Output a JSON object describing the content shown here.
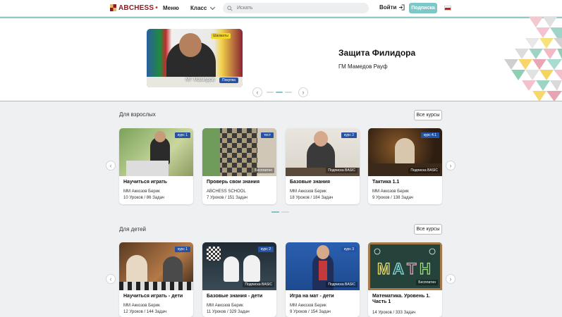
{
  "header": {
    "logo": "ABCHESS",
    "menu": "Меню",
    "class": "Класс",
    "search_placeholder": "Искать",
    "login": "Войти",
    "subscribe": "Подписка"
  },
  "hero": {
    "title": "Защита Филидора",
    "author": "ГМ Мамедов Рауф",
    "image_label": "МГ Мамедов",
    "tag": "Шахматы",
    "badge": "Покупка",
    "dots": 3,
    "active_dot": 1
  },
  "adults": {
    "title": "Для взрослых",
    "all": "Все курсы",
    "courses": [
      {
        "title": "Научиться играть",
        "author": "ММ Аккозов Берик",
        "meta": "10 Уроков / 86 Задач",
        "tag": "курс 1",
        "sub": ""
      },
      {
        "title": "Проверь свои знания",
        "author": "ABCHESS SCHOOL",
        "meta": "7 Уроков / 151 Задач",
        "tag": "тест",
        "sub": "Бесплатно"
      },
      {
        "title": "Базовые знания",
        "author": "ММ Аккозов Берик",
        "meta": "18 Уроков / 184 Задач",
        "tag": "курс 2",
        "sub": "Подписка BASIC"
      },
      {
        "title": "Тактика 1.1",
        "author": "ММ Аккозов Берик",
        "meta": "9 Уроков / 138 Задач",
        "tag": "курс 4.1",
        "sub": "Подписка BASIC"
      }
    ]
  },
  "kids": {
    "title": "Для детей",
    "all": "Все курсы",
    "courses": [
      {
        "title": "Научиться играть - дети",
        "author": "ММ Аккозов Берик",
        "meta": "12 Уроков / 144 Задач",
        "tag": "курс 1",
        "sub": ""
      },
      {
        "title": "Базовые знания - дети",
        "author": "ММ Аккозов Берик",
        "meta": "11 Уроков / 329 Задач",
        "tag": "курс 2",
        "sub": "Подписка BASIC"
      },
      {
        "title": "Игра на мат - дети",
        "author": "ММ Аккозов Берик",
        "meta": "9 Уроков / 154 Задач",
        "tag": "курс 3",
        "sub": "Подписка BASIC"
      },
      {
        "title": "Математика. Уровень 1. Часть 1",
        "author": "",
        "meta": "14 Уроков / 333 Задач",
        "tag": "",
        "sub": "Бесплатно"
      }
    ]
  },
  "colors": {
    "accent": "#7ec7c9",
    "badge": "#2453a6",
    "brand": "#8b1c24"
  }
}
